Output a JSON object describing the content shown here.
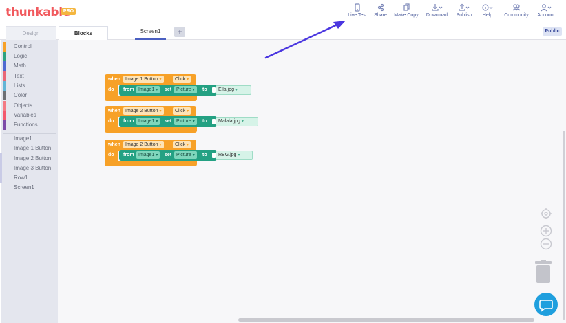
{
  "app": {
    "logo_text": "thunkable",
    "logo_badge": "PRO",
    "brand_color": "#f15a5e"
  },
  "topnav": {
    "live_test": "Live Test",
    "share": "Share",
    "make_copy": "Make Copy",
    "download": "Download",
    "publish": "Publish",
    "help": "Help",
    "community": "Community",
    "account": "Account"
  },
  "tabs": {
    "design": "Design",
    "blocks": "Blocks",
    "screen": "Screen1",
    "add": "+",
    "visibility": "Public"
  },
  "sidebar": {
    "categories": [
      {
        "label": "Control",
        "color": "#f7a128"
      },
      {
        "label": "Logic",
        "color": "#2fa27f"
      },
      {
        "label": "Math",
        "color": "#4f6ad1"
      },
      {
        "label": "Text",
        "color": "#e96777"
      },
      {
        "label": "Lists",
        "color": "#62b5d6"
      },
      {
        "label": "Color",
        "color": "#6d6f74"
      },
      {
        "label": "Objects",
        "color": "#f37a84"
      },
      {
        "label": "Variables",
        "color": "#f3596e"
      },
      {
        "label": "Functions",
        "color": "#7d4ba8"
      }
    ],
    "components": [
      "Image1",
      "Image 1 Button",
      "Image 2 Button",
      "Image 3 Button",
      "Row1",
      "Screen1"
    ]
  },
  "blocks": [
    {
      "when": "when",
      "component": "Image 1 Button",
      "event": "Click",
      "do": "do",
      "from": "from",
      "target": "Image1",
      "set": "set",
      "property": "Picture",
      "to": "to",
      "value": "Ella.jpg"
    },
    {
      "when": "when",
      "component": "Image 2 Button",
      "event": "Click",
      "do": "do",
      "from": "from",
      "target": "Image1",
      "set": "set",
      "property": "Picture",
      "to": "to",
      "value": "Malala.jpg"
    },
    {
      "when": "when",
      "component": "Image 2 Button",
      "event": "Click",
      "do": "do",
      "from": "from",
      "target": "Image1",
      "set": "set",
      "property": "Picture",
      "to": "to",
      "value": "RBG.jpg"
    }
  ],
  "icons": {
    "live_test": "phone-icon",
    "share": "share-icon",
    "make_copy": "copy-icon",
    "download": "download-icon",
    "publish": "upload-icon",
    "help": "help-icon",
    "community": "community-icon",
    "account": "user-icon",
    "recenter": "target-icon",
    "zoom_in": "zoom-in-icon",
    "zoom_out": "zoom-out-icon",
    "trash": "trash-icon",
    "chat": "chat-icon"
  },
  "colors": {
    "event_block": "#f7a128",
    "set_block": "#24a183",
    "arrow": "#4a36e0",
    "chat": "#1f9fde"
  }
}
